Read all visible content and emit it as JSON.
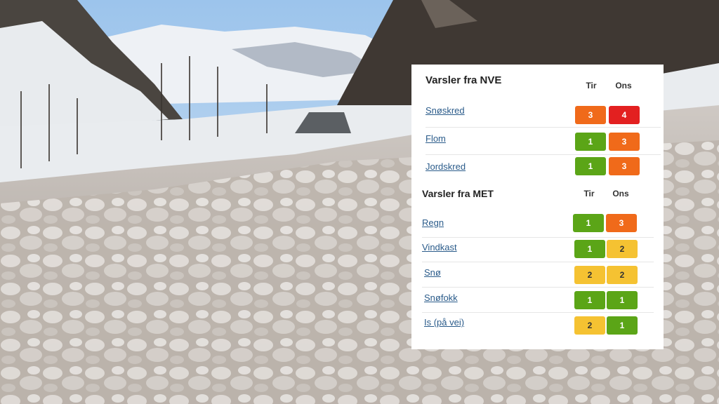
{
  "nve": {
    "title": "Varsler fra NVE",
    "col1": "Tir",
    "col2": "Ons",
    "rows": [
      {
        "label": "Snøskred",
        "tir": "3",
        "ons": "4"
      },
      {
        "label": "Flom",
        "tir": "1",
        "ons": "3"
      },
      {
        "label": "Jordskred",
        "tir": "1",
        "ons": "3"
      }
    ]
  },
  "met": {
    "title": "Varsler fra MET",
    "col1": "Tir",
    "col2": "Ons",
    "rows": [
      {
        "label": "Regn",
        "tir": "1",
        "ons": "3"
      },
      {
        "label": "Vindkast",
        "tir": "1",
        "ons": "2"
      },
      {
        "label": "Snø",
        "tir": "2",
        "ons": "2"
      },
      {
        "label": "Snøfokk",
        "tir": "1",
        "ons": "1"
      },
      {
        "label": "Is (på vei)",
        "tir": "2",
        "ons": "1"
      }
    ]
  },
  "colors": {
    "level1": "#5ba517",
    "level2": "#f5c232",
    "level3": "#f06a1a",
    "level4": "#e32020"
  }
}
